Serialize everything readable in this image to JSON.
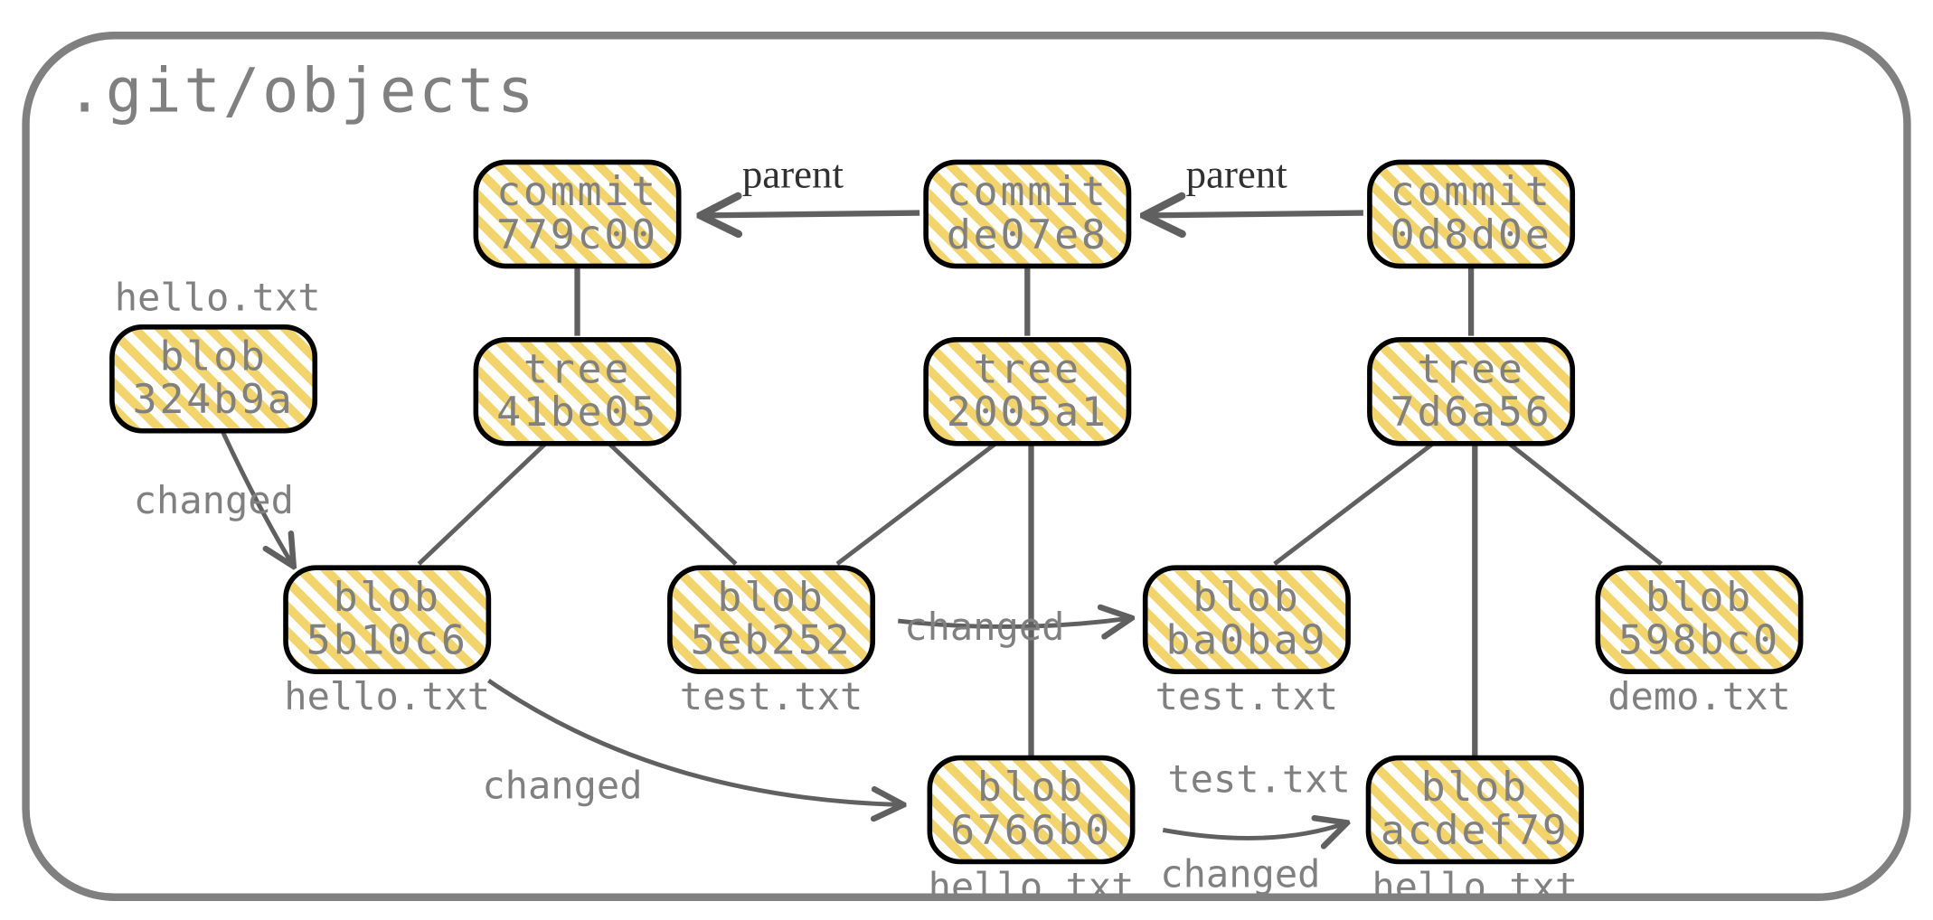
{
  "frame": {
    "title": ".git/objects"
  },
  "nodes": {
    "commit1": {
      "type": "commit",
      "hash": "779c00"
    },
    "commit2": {
      "type": "commit",
      "hash": "de07e8"
    },
    "commit3": {
      "type": "commit",
      "hash": "0d8d0e"
    },
    "tree1": {
      "type": "tree",
      "hash": "41be05"
    },
    "tree2": {
      "type": "tree",
      "hash": "2005a1"
    },
    "tree3": {
      "type": "tree",
      "hash": "7d6a56"
    },
    "blobA": {
      "type": "blob",
      "hash": "324b9a"
    },
    "blobB": {
      "type": "blob",
      "hash": "5b10c6"
    },
    "blobC": {
      "type": "blob",
      "hash": "5eb252"
    },
    "blobD": {
      "type": "blob",
      "hash": "ba0ba9"
    },
    "blobE": {
      "type": "blob",
      "hash": "598bc0"
    },
    "blobF": {
      "type": "blob",
      "hash": "6766b0"
    },
    "blobG": {
      "type": "blob",
      "hash": "acdef79"
    }
  },
  "labels": {
    "parent1": "parent",
    "parent2": "parent",
    "changedA": "changed",
    "changedC": "changed",
    "changedB": "changed",
    "changedF": "changed",
    "helloA": "hello.txt",
    "helloB": "hello.txt",
    "testC": "test.txt",
    "testD": "test.txt",
    "demoE": "demo.txt",
    "testSide": "test.txt",
    "helloF": "hello.txt",
    "helloG": "hello.txt"
  }
}
